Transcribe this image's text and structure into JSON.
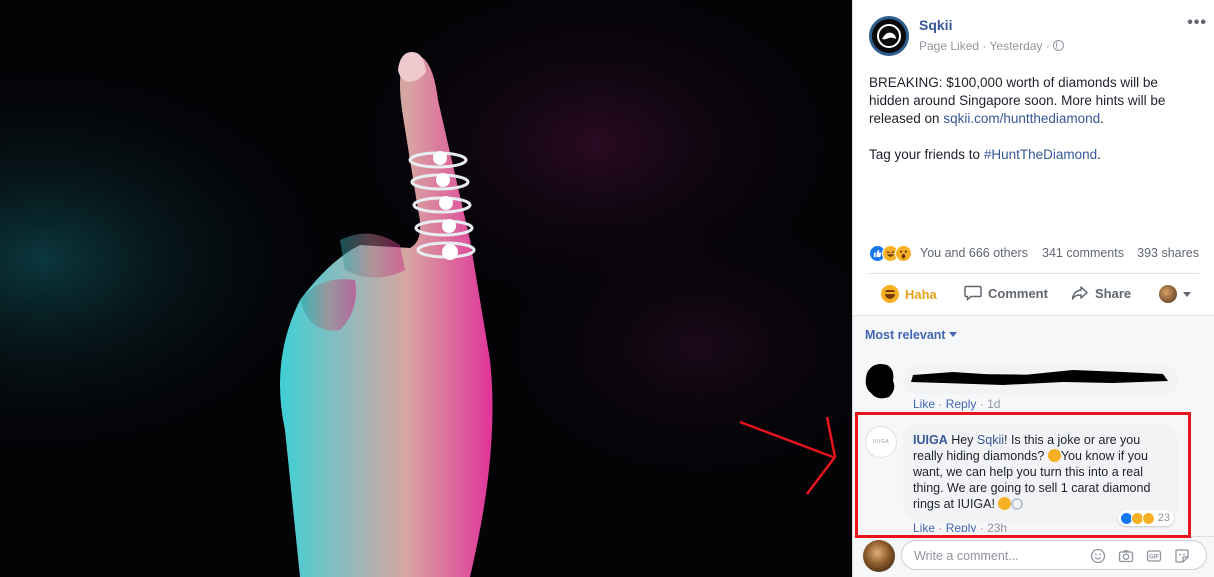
{
  "post": {
    "page_name": "Sqkii",
    "meta": "Page Liked · Yesterday ·",
    "text_line1_prefix": "BREAKING: $100,000 worth of diamonds will be hidden around Singapore soon. More hints will be released on ",
    "link": "sqkii.com/huntthediamond",
    "text_line1_suffix": ".",
    "text_line2_prefix": "Tag your friends to ",
    "hashtag": "#HuntTheDiamond",
    "text_line2_suffix": "."
  },
  "stats": {
    "reactions": "You and 666 others",
    "comments": "341 comments",
    "shares": "393 shares"
  },
  "actions": {
    "haha": "Haha",
    "comment": "Comment",
    "share": "Share"
  },
  "comments": {
    "sort_label": "Most relevant",
    "first": {
      "like": "Like",
      "reply": "Reply",
      "time": "1d"
    },
    "second": {
      "avatar_text": "IUIGA",
      "author": "IUIGA",
      "prefix": " Hey ",
      "mention": "Sqkii",
      "body1": "! Is this a joke or are you really hiding diamonds? ",
      "body2": "You know if you want, we can help you turn this into a real thing. We are going to sell 1 carat diamond rings at IUIGA! ",
      "reaction_count": "23",
      "like": "Like",
      "reply": "Reply",
      "time": "23h"
    },
    "write_placeholder": "Write a comment..."
  },
  "colors": {
    "link": "#365899",
    "accent": "#4267b2",
    "annotation": "#e8141c"
  },
  "icons": [
    "more-icon",
    "globe-icon",
    "like-icon",
    "haha-icon",
    "wow-icon",
    "comment-icon",
    "share-icon",
    "emoji-icon",
    "camera-icon",
    "gif-icon",
    "sticker-icon"
  ]
}
